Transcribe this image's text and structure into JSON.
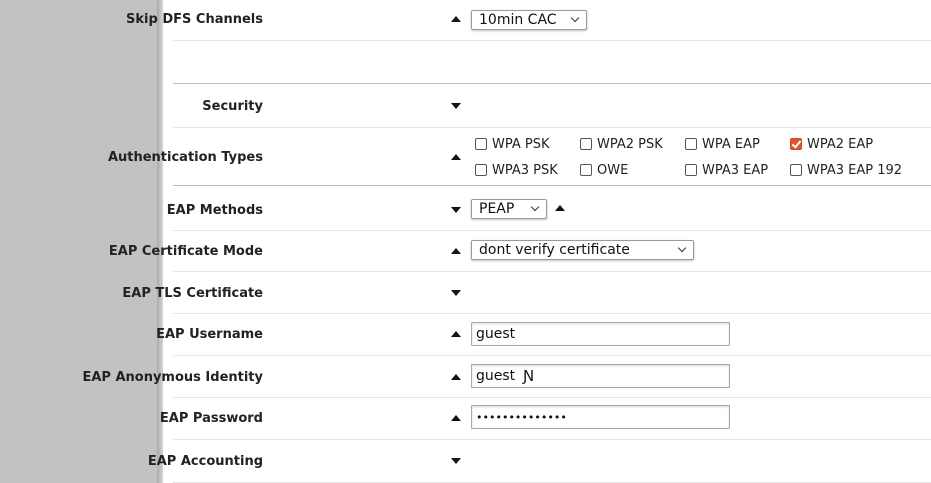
{
  "skip_dfs": {
    "label": "Skip DFS Channels",
    "value": "10min CAC"
  },
  "security": {
    "label": "Security"
  },
  "auth_types": {
    "label": "Authentication Types",
    "options": [
      {
        "label": "WPA PSK",
        "checked": false
      },
      {
        "label": "WPA2 PSK",
        "checked": false
      },
      {
        "label": "WPA EAP",
        "checked": false
      },
      {
        "label": "WPA2 EAP",
        "checked": true
      },
      {
        "label": "WPA3 PSK",
        "checked": false
      },
      {
        "label": "OWE",
        "checked": false
      },
      {
        "label": "WPA3 EAP",
        "checked": false
      },
      {
        "label": "WPA3 EAP 192",
        "checked": false
      }
    ]
  },
  "eap_methods": {
    "label": "EAP Methods",
    "value": "PEAP"
  },
  "eap_cert_mode": {
    "label": "EAP Certificate Mode",
    "value": "dont verify certificate"
  },
  "eap_tls_cert": {
    "label": "EAP TLS Certificate"
  },
  "eap_username": {
    "label": "EAP Username",
    "value": "guest"
  },
  "eap_anon_identity": {
    "label": "EAP Anonymous Identity",
    "value": "guest"
  },
  "eap_password": {
    "label": "EAP Password",
    "value": "••••••••••••••"
  },
  "eap_accounting": {
    "label": "EAP Accounting"
  },
  "colors": {
    "checkbox_checked": "#e0582a",
    "sidebar": "#c2c2c2"
  }
}
